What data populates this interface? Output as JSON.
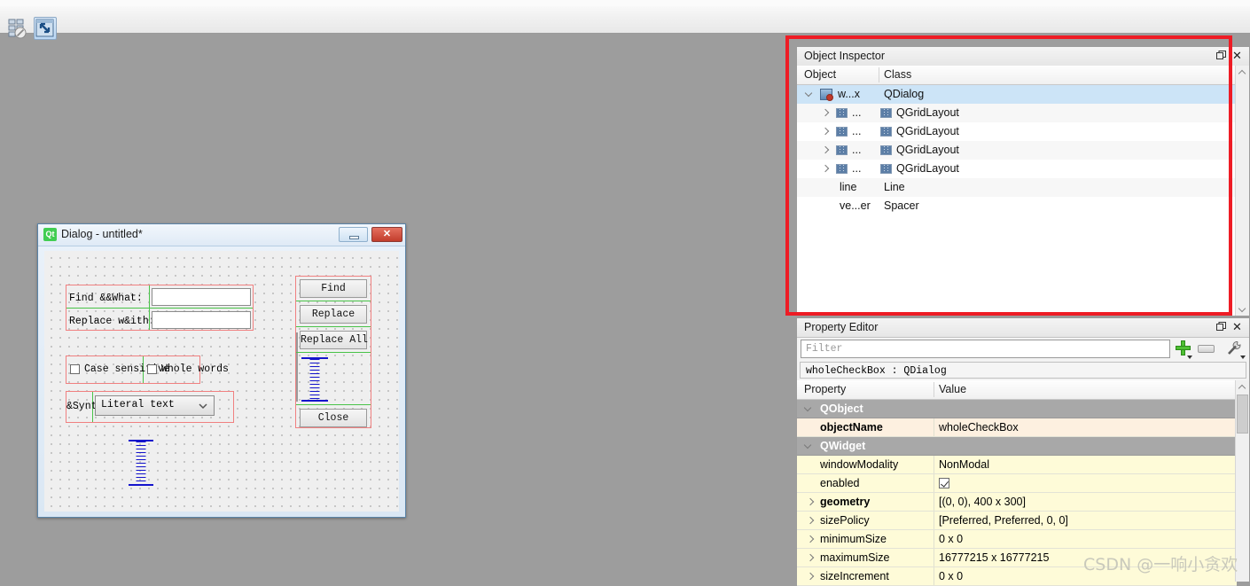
{
  "app": {
    "workspace_bg": "#9d9d9d",
    "toolbar": {
      "buttons": [
        {
          "name": "break-layout",
          "tooltip": "Break Layout",
          "selected": false
        },
        {
          "name": "adjust-size",
          "tooltip": "Adjust Size",
          "selected": true
        }
      ]
    }
  },
  "dialog": {
    "title": "Dialog - untitled*",
    "logo_text": "Qt",
    "minimize_label": "",
    "close_label": "✕",
    "labels": {
      "find_what": "Find &&What:",
      "replace_with": "Replace w&ith:",
      "syntax": "&Syntax:"
    },
    "fields": {
      "find_value": "",
      "replace_value": ""
    },
    "checkboxes": [
      {
        "label": "Case sensitive",
        "checked": false
      },
      {
        "label": "Whole words",
        "checked": false
      }
    ],
    "combo": {
      "value": "Literal text"
    },
    "buttons": [
      {
        "label": "Find"
      },
      {
        "label": "Replace"
      },
      {
        "label": "Replace All"
      },
      {
        "label": "Close"
      }
    ]
  },
  "object_inspector": {
    "title": "Object Inspector",
    "float_icon": "float-icon",
    "close_icon": "✕",
    "columns": [
      "Object",
      "Class"
    ],
    "rows": [
      {
        "object": "w...x",
        "class": "QDialog",
        "depth": 0,
        "expanded": true,
        "selected": true,
        "icon": "dialog-icon"
      },
      {
        "object": "...",
        "class": "QGridLayout",
        "depth": 1,
        "expanded": false,
        "selected": false,
        "icon": "grid-icon"
      },
      {
        "object": "...",
        "class": "QGridLayout",
        "depth": 1,
        "expanded": false,
        "selected": false,
        "icon": "grid-icon"
      },
      {
        "object": "...",
        "class": "QGridLayout",
        "depth": 1,
        "expanded": false,
        "selected": false,
        "icon": "grid-icon"
      },
      {
        "object": "...",
        "class": "QGridLayout",
        "depth": 1,
        "expanded": false,
        "selected": false,
        "icon": "grid-icon"
      },
      {
        "object": "line",
        "class": "Line",
        "depth": 1,
        "expanded": null,
        "selected": false,
        "icon": ""
      },
      {
        "object": "ve...er",
        "class": "Spacer",
        "depth": 1,
        "expanded": null,
        "selected": false,
        "icon": ""
      }
    ]
  },
  "property_editor": {
    "title": "Property Editor",
    "float_icon": "float-icon",
    "close_icon": "✕",
    "filter_placeholder": "Filter",
    "filter_value": "",
    "toolbar_icons": [
      "add-icon",
      "remove-icon",
      "configure-icon"
    ],
    "selected_object": "wholeCheckBox : QDialog",
    "columns": [
      "Property",
      "Value"
    ],
    "rows": [
      {
        "name": "QObject",
        "value": "",
        "group": true,
        "expanded": true,
        "bold": true
      },
      {
        "name": "objectName",
        "value": "wholeCheckBox",
        "group": false,
        "bold": true,
        "expandable": false
      },
      {
        "name": "QWidget",
        "value": "",
        "group": true,
        "expanded": true,
        "bold": true
      },
      {
        "name": "windowModality",
        "value": "NonModal",
        "group": false,
        "bold": false,
        "expandable": false
      },
      {
        "name": "enabled",
        "value": "",
        "group": false,
        "bold": false,
        "expandable": false,
        "checkbox": true,
        "checked": true
      },
      {
        "name": "geometry",
        "value": "[(0, 0), 400 x 300]",
        "group": false,
        "bold": true,
        "expandable": true
      },
      {
        "name": "sizePolicy",
        "value": "[Preferred, Preferred, 0, 0]",
        "group": false,
        "bold": false,
        "expandable": true
      },
      {
        "name": "minimumSize",
        "value": "0 x 0",
        "group": false,
        "bold": false,
        "expandable": true
      },
      {
        "name": "maximumSize",
        "value": "16777215 x 16777215",
        "group": false,
        "bold": false,
        "expandable": true
      },
      {
        "name": "sizeIncrement",
        "value": "0 x 0",
        "group": false,
        "bold": false,
        "expandable": true
      }
    ]
  },
  "annotation": {
    "color": "#ee1c25"
  },
  "watermark": {
    "text": "CSDN @一响小贪欢"
  }
}
